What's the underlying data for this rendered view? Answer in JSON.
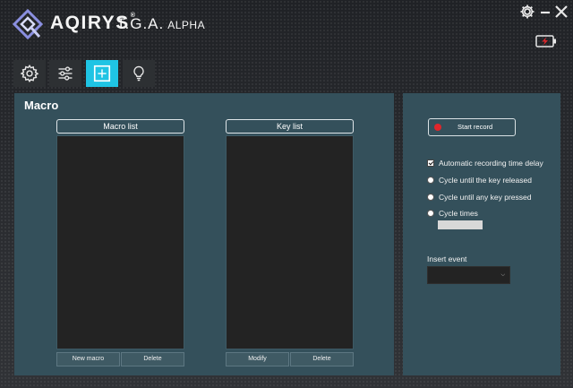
{
  "app": {
    "brand": "AQIRYS",
    "brand_mark": "®",
    "subtitle": "T.G.A.",
    "edition": "ALPHA"
  },
  "colors": {
    "accent": "#1fc4e4",
    "panel": "#34505b",
    "list_bg": "#232323",
    "record_dot": "#e0262b"
  },
  "window_controls": [
    "gear-icon",
    "minimize-icon",
    "close-icon"
  ],
  "nav_tabs": [
    {
      "name": "settings",
      "icon": "gear-icon",
      "active": false
    },
    {
      "name": "adjust",
      "icon": "sliders-icon",
      "active": false
    },
    {
      "name": "macro",
      "icon": "plus-square-icon",
      "active": true
    },
    {
      "name": "lighting",
      "icon": "lightbulb-icon",
      "active": false
    }
  ],
  "section_title": "Macro",
  "macro_list": {
    "header": "Macro list",
    "new_label": "New macro",
    "delete_label": "Delete"
  },
  "key_list": {
    "header": "Key list",
    "modify_label": "Modify",
    "delete_label": "Delete"
  },
  "record": {
    "start_label": "Start record",
    "options": [
      {
        "type": "checkbox",
        "label": "Automatic recording time delay",
        "checked": true
      },
      {
        "type": "radio",
        "label": "Cycle until the key released",
        "checked": false
      },
      {
        "type": "radio",
        "label": "Cycle until any key pressed",
        "checked": false
      },
      {
        "type": "radio",
        "label": "Cycle times",
        "checked": false
      }
    ],
    "cycle_times_value": "",
    "insert_event_label": "Insert event",
    "insert_event_value": ""
  }
}
